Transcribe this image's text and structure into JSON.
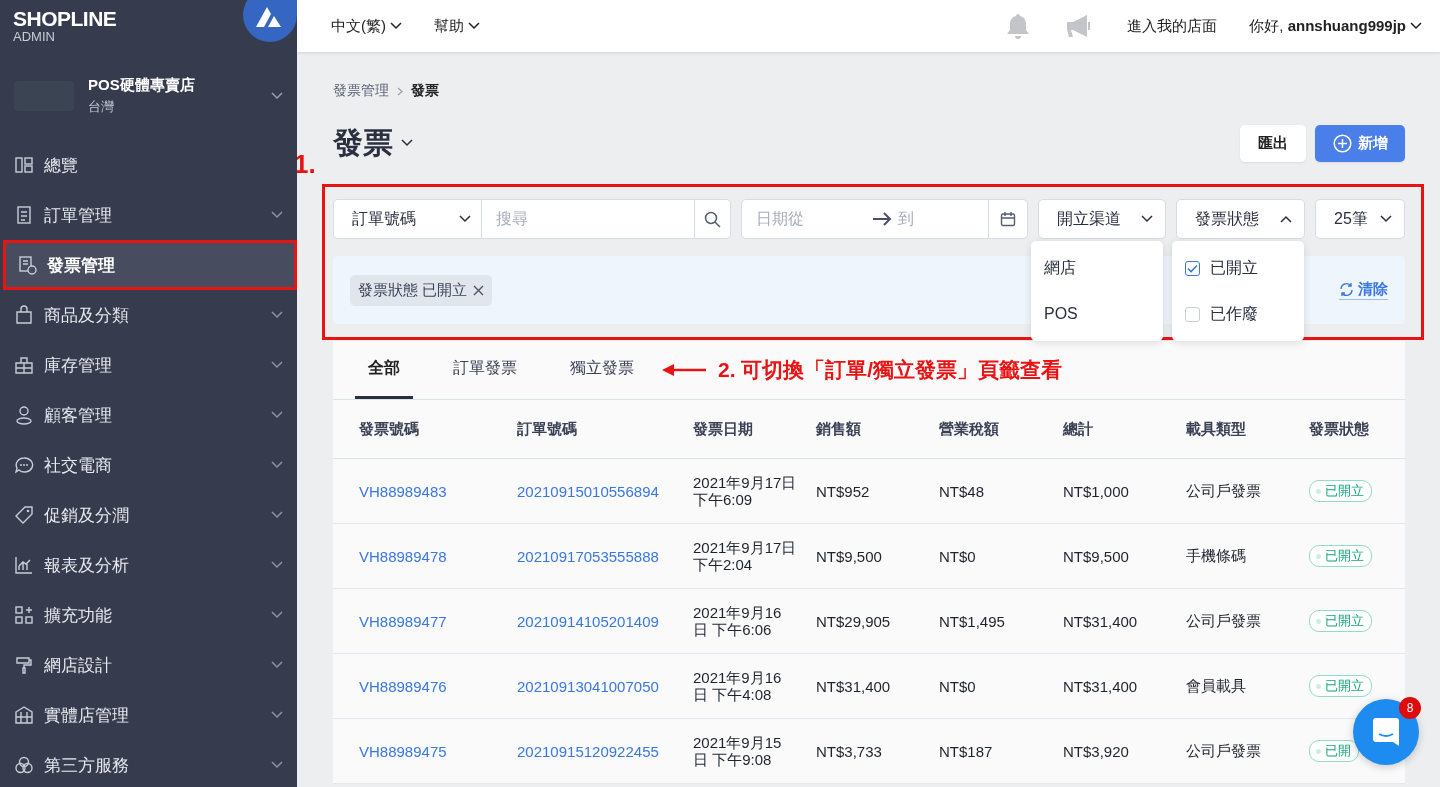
{
  "brand": {
    "name": "SHOPLINE",
    "sub": "ADMIN"
  },
  "store": {
    "name": "POS硬體專賣店",
    "region": "台灣"
  },
  "sidebar": {
    "items": [
      {
        "label": "總覽",
        "expandable": false,
        "selected": false,
        "highlighted": false
      },
      {
        "label": "訂單管理",
        "expandable": true,
        "selected": false,
        "highlighted": false
      },
      {
        "label": "發票管理",
        "expandable": false,
        "selected": true,
        "highlighted": true
      },
      {
        "label": "商品及分類",
        "expandable": true,
        "selected": false,
        "highlighted": false
      },
      {
        "label": "庫存管理",
        "expandable": true,
        "selected": false,
        "highlighted": false
      },
      {
        "label": "顧客管理",
        "expandable": true,
        "selected": false,
        "highlighted": false
      },
      {
        "label": "社交電商",
        "expandable": true,
        "selected": false,
        "highlighted": false
      },
      {
        "label": "促銷及分潤",
        "expandable": true,
        "selected": false,
        "highlighted": false
      },
      {
        "label": "報表及分析",
        "expandable": true,
        "selected": false,
        "highlighted": false
      },
      {
        "label": "擴充功能",
        "expandable": true,
        "selected": false,
        "highlighted": false
      },
      {
        "label": "網店設計",
        "expandable": true,
        "selected": false,
        "highlighted": false
      },
      {
        "label": "實體店管理",
        "expandable": true,
        "selected": false,
        "highlighted": false
      },
      {
        "label": "第三方服務",
        "expandable": true,
        "selected": false,
        "highlighted": false
      }
    ]
  },
  "topbar": {
    "menus": [
      "中文(繁)",
      "幫助"
    ],
    "storefront_link": "進入我的店面",
    "greeting": "你好, **annshuang999jp**"
  },
  "breadcrumb": [
    "發票管理",
    "發票"
  ],
  "page_title": "發票",
  "actions": {
    "export": "匯出",
    "create": "新增"
  },
  "filters": {
    "search_field": "訂單號碼",
    "search_placeholder": "搜尋",
    "date_from_placeholder": "日期從",
    "date_to_placeholder": "到",
    "channel": {
      "label": "開立渠道",
      "expanded": false,
      "options": [
        "網店",
        "POS"
      ]
    },
    "status": {
      "label": "發票狀態",
      "expanded": true,
      "options": [
        {
          "label": "已開立",
          "checked": true
        },
        {
          "label": "已作廢",
          "checked": false
        }
      ]
    },
    "page_size": "25筆",
    "active_chips": [
      "發票狀態 已開立"
    ],
    "clear": "清除"
  },
  "tabs": [
    {
      "label": "全部",
      "selected": true
    },
    {
      "label": "訂單發票",
      "selected": false
    },
    {
      "label": "獨立發票",
      "selected": false
    }
  ],
  "table": {
    "columns": [
      "發票號碼",
      "訂單號碼",
      "發票日期",
      "銷售額",
      "營業稅額",
      "總計",
      "載具類型",
      "發票狀態"
    ],
    "rows": [
      {
        "invoice": "VH88989483",
        "order": "20210915010556894",
        "date": "2021年9月17日",
        "time": "下午6:09",
        "sales": "NT$952",
        "tax": "NT$48",
        "total": "NT$1,000",
        "carrier": "公司戶發票",
        "status": "已開立"
      },
      {
        "invoice": "VH88989478",
        "order": "20210917053555888",
        "date": "2021年9月17日",
        "time": "下午2:04",
        "sales": "NT$9,500",
        "tax": "NT$0",
        "total": "NT$9,500",
        "carrier": "手機條碼",
        "status": "已開立"
      },
      {
        "invoice": "VH88989477",
        "order": "20210914105201409",
        "date": "2021年9月16",
        "time": "日 下午6:06",
        "sales": "NT$29,905",
        "tax": "NT$1,495",
        "total": "NT$31,400",
        "carrier": "公司戶發票",
        "status": "已開立"
      },
      {
        "invoice": "VH88989476",
        "order": "20210913041007050",
        "date": "2021年9月16",
        "time": "日 下午4:08",
        "sales": "NT$31,400",
        "tax": "NT$0",
        "total": "NT$31,400",
        "carrier": "會員載具",
        "status": "已開立"
      },
      {
        "invoice": "VH88989475",
        "order": "20210915120922455",
        "date": "2021年9月15",
        "time": "日 下午9:08",
        "sales": "NT$3,733",
        "tax": "NT$187",
        "total": "NT$3,920",
        "carrier": "公司戶發票",
        "status": "已開"
      }
    ]
  },
  "annotations": {
    "step1": "1.",
    "step2": "2. 可切換「訂單/獨立發票」頁籤查看"
  },
  "chat": {
    "badge": "8"
  }
}
